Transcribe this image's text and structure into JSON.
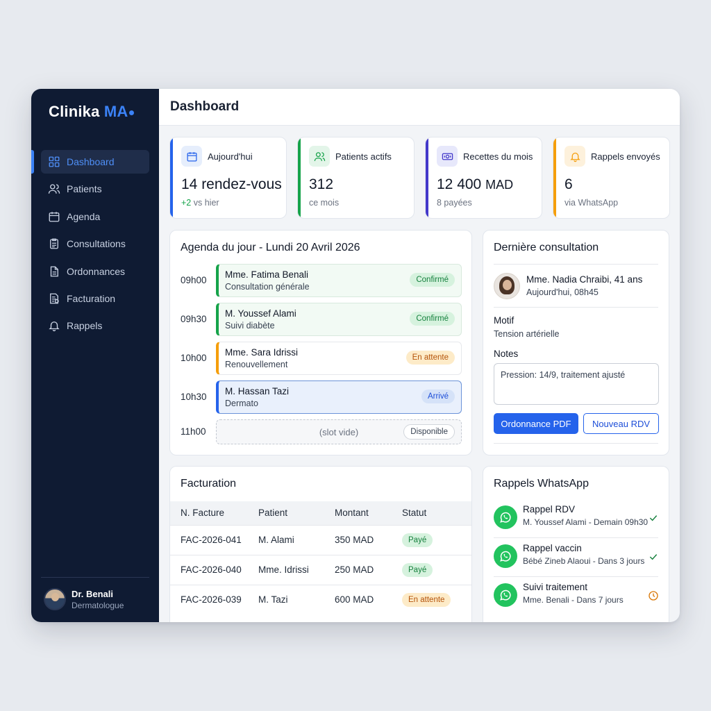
{
  "app": {
    "logo_main": "Clinika",
    "logo_accent": "MA",
    "page_title": "Dashboard"
  },
  "sidebar": {
    "items": [
      {
        "label": "Dashboard",
        "icon": "grid-icon",
        "active": true
      },
      {
        "label": "Patients",
        "icon": "users-icon"
      },
      {
        "label": "Agenda",
        "icon": "calendar-icon"
      },
      {
        "label": "Consultations",
        "icon": "clipboard-icon"
      },
      {
        "label": "Ordonnances",
        "icon": "document-icon"
      },
      {
        "label": "Facturation",
        "icon": "invoice-icon"
      },
      {
        "label": "Rappels",
        "icon": "bell-icon"
      }
    ],
    "user": {
      "name": "Dr. Benali",
      "role": "Dermatologue"
    }
  },
  "stats": [
    {
      "label": "Aujourd'hui",
      "value": "14 rendez-vous",
      "sub_positive": "+2",
      "sub": " vs hier",
      "icon": "calendar-icon",
      "color": "#2563eb"
    },
    {
      "label": "Patients actifs",
      "value": "312",
      "sub": "ce mois",
      "icon": "users-icon",
      "color": "#16a34a"
    },
    {
      "label": "Recettes du mois",
      "value": "12 400",
      "unit": "MAD",
      "sub": "8 payées",
      "icon": "banknote-icon",
      "color": "#4338ca"
    },
    {
      "label": "Rappels envoyés",
      "value": "6",
      "sub": "via WhatsApp",
      "icon": "bell-icon",
      "color": "#f59e0b"
    }
  ],
  "agenda": {
    "title": "Agenda du jour - Lundi 20 Avril 2026",
    "slots": [
      {
        "time": "09h00",
        "patient": "Mme. Fatima Benali",
        "type": "Consultation générale",
        "status": "Confirmé"
      },
      {
        "time": "09h30",
        "patient": "M. Youssef Alami",
        "type": "Suivi diabète",
        "status": "Confirmé"
      },
      {
        "time": "10h00",
        "patient": "Mme. Sara Idrissi",
        "type": "Renouvellement",
        "status": "En attente"
      },
      {
        "time": "10h30",
        "patient": "M. Hassan Tazi",
        "type": "Dermato",
        "status": "Arrivé"
      },
      {
        "time": "11h00",
        "empty_text": "(slot vide)",
        "status": "Disponible"
      }
    ]
  },
  "consultation": {
    "title": "Dernière consultation",
    "patient": "Mme. Nadia Chraibi, 41 ans",
    "date": "Aujourd'hui, 08h45",
    "motif_label": "Motif",
    "motif": "Tension artérielle",
    "notes_label": "Notes",
    "notes": "Pression: 14/9, traitement ajusté",
    "btn_primary": "Ordonnance PDF",
    "btn_secondary": "Nouveau RDV"
  },
  "facturation": {
    "title": "Facturation",
    "columns": [
      "N. Facture",
      "Patient",
      "Montant",
      "Statut"
    ],
    "rows": [
      {
        "id": "FAC-2026-041",
        "patient": "M. Alami",
        "montant": "350 MAD",
        "statut": "Payé"
      },
      {
        "id": "FAC-2026-040",
        "patient": "Mme. Idrissi",
        "montant": "250 MAD",
        "statut": "Payé"
      },
      {
        "id": "FAC-2026-039",
        "patient": "M. Tazi",
        "montant": "600 MAD",
        "statut": "En attente"
      }
    ]
  },
  "rappels": {
    "title": "Rappels WhatsApp",
    "items": [
      {
        "title": "Rappel RDV",
        "sub": "M. Youssef Alami - Demain 09h30",
        "status": "check-icon"
      },
      {
        "title": "Rappel vaccin",
        "sub": "Bébé Zineb Alaoui - Dans 3 jours",
        "status": "check-icon"
      },
      {
        "title": "Suivi traitement",
        "sub": "Mme. Benali - Dans 7 jours",
        "status": "clock-icon"
      }
    ]
  },
  "colors": {
    "sidebar": "#0f1b33",
    "accent": "#2563eb",
    "success": "#16a34a",
    "warning": "#f59e0b"
  }
}
